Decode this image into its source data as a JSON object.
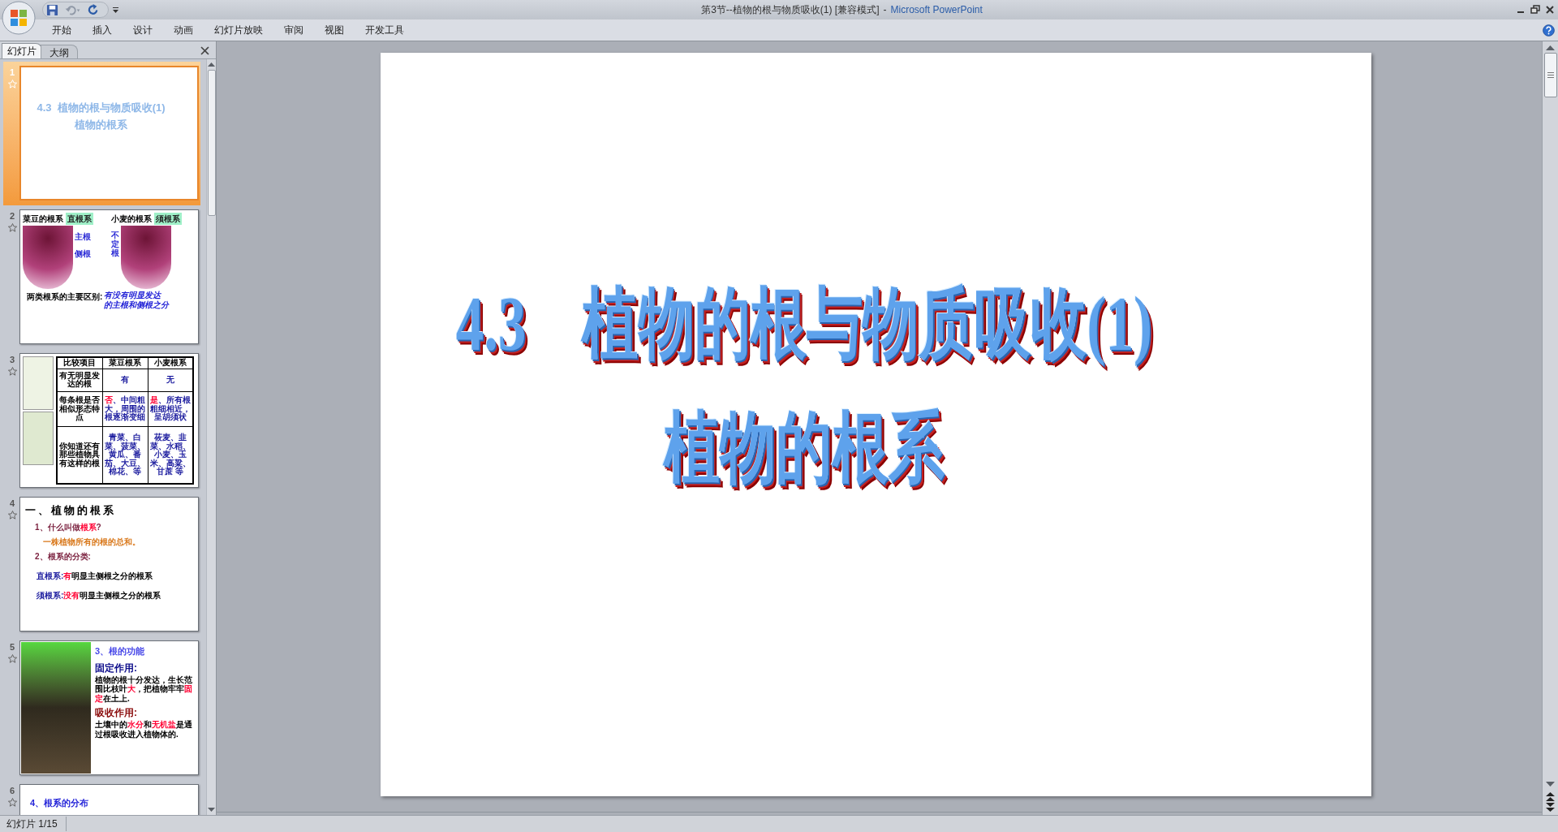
{
  "window": {
    "title": "第3节--植物的根与物质吸收(1) [兼容模式]",
    "separator": "-",
    "app": "Microsoft PowerPoint"
  },
  "ribbon_tabs": [
    "开始",
    "插入",
    "设计",
    "动画",
    "幻灯片放映",
    "审阅",
    "视图",
    "开发工具"
  ],
  "panel_tabs": [
    {
      "label": "幻灯片",
      "selected": true
    },
    {
      "label": "大纲",
      "selected": false
    }
  ],
  "thumbnails": [
    {
      "number": "1",
      "selected": true,
      "kind": "title",
      "lines": [
        "4.3  植物的根与物质吸收(1)",
        "植物的根系"
      ]
    },
    {
      "number": "2",
      "selected": false,
      "kind": "root-diagram",
      "panels": [
        {
          "caption": "菜豆的根系",
          "tag": "直根系",
          "labels": [
            "主根",
            "侧根"
          ]
        },
        {
          "caption": "小麦的根系",
          "tag": "须根系",
          "labels": [
            "不定根"
          ]
        }
      ],
      "summary_label": "两类根系的主要区别:",
      "summary_text": [
        "有没有明显发达",
        "的主根和侧根之分"
      ]
    },
    {
      "number": "3",
      "selected": false,
      "kind": "table",
      "columns": [
        "比较项目",
        "菜豆根系",
        "小麦根系"
      ],
      "rows": [
        [
          [
            {
              "text": "有无明显发达的根",
              "kind": "none"
            }
          ],
          [
            {
              "text": "有",
              "kind": "term"
            }
          ],
          [
            {
              "text": "无",
              "kind": "term"
            }
          ]
        ],
        [
          [
            {
              "text": "每条根是否相似形态特点",
              "kind": "none"
            }
          ],
          [
            {
              "text": "否",
              "kind": "mark"
            },
            {
              "text": "、中间粗大，周围的根逐渐变细",
              "kind": "term"
            }
          ],
          [
            {
              "text": "是",
              "kind": "mark"
            },
            {
              "text": "、所有根粗细相近，呈胡须状",
              "kind": "term"
            }
          ]
        ],
        [
          [
            {
              "text": "你知道还有那些植物具有这样的根",
              "kind": "none"
            }
          ],
          [
            {
              "text": "青菜、白菜、菠菜、黄瓜、番茄、大豆、棉花、等",
              "kind": "term"
            }
          ],
          [
            {
              "text": "莜麦、韭菜、水稻、小麦、玉米、高粱、甘蔗 等",
              "kind": "term"
            }
          ]
        ]
      ]
    },
    {
      "number": "4",
      "selected": false,
      "kind": "outline",
      "heading": "一、植物的根系",
      "paragraphs": [
        {
          "kind": "question",
          "segments": [
            {
              "text": "1、什么叫做",
              "kind": "none"
            },
            {
              "text": "根系",
              "kind": "mark"
            },
            {
              "text": "?",
              "kind": "none"
            }
          ]
        },
        {
          "kind": "answer",
          "segments": [
            {
              "text": "一株植物所有的根的总和。",
              "kind": "none"
            }
          ]
        },
        {
          "kind": "question",
          "segments": [
            {
              "text": "2、根系的分类:",
              "kind": "none"
            }
          ]
        },
        {
          "kind": "definition",
          "segments": [
            {
              "text": "直根系:",
              "kind": "term"
            },
            {
              "text": "有",
              "kind": "mark"
            },
            {
              "text": "明显主侧根之分的根系",
              "kind": "none"
            }
          ]
        },
        {
          "kind": "definition",
          "segments": [
            {
              "text": "须根系:",
              "kind": "term"
            },
            {
              "text": "没有",
              "kind": "mark"
            },
            {
              "text": "明显主侧根之分的根系",
              "kind": "none"
            }
          ]
        }
      ]
    },
    {
      "number": "5",
      "selected": false,
      "kind": "photo-text",
      "heading": "3、根的功能",
      "sections": [
        {
          "title": "固定作用:",
          "segments": [
            {
              "text": "植物的根十分发达，生长范围比枝叶",
              "kind": "none"
            },
            {
              "text": "大",
              "kind": "mark"
            },
            {
              "text": "，把植物牢牢",
              "kind": "none"
            },
            {
              "text": "固定",
              "kind": "mark"
            },
            {
              "text": "在土上.",
              "kind": "none"
            }
          ]
        },
        {
          "title": "吸收作用:",
          "segments": [
            {
              "text": "土壤中的",
              "kind": "none"
            },
            {
              "text": "水分",
              "kind": "mark"
            },
            {
              "text": "和",
              "kind": "none"
            },
            {
              "text": "无机盐",
              "kind": "mark"
            },
            {
              "text": "是通过根吸收进入植物体的.",
              "kind": "none"
            }
          ]
        }
      ]
    },
    {
      "number": "6",
      "selected": false,
      "kind": "partial",
      "heading": "4、根系的分布"
    }
  ],
  "slide": {
    "title_lines": [
      "4.3　植物的根与物质吸收(1)",
      "植物的根系"
    ]
  },
  "status_bar": {
    "slide_indicator": "幻灯片 1/15"
  }
}
